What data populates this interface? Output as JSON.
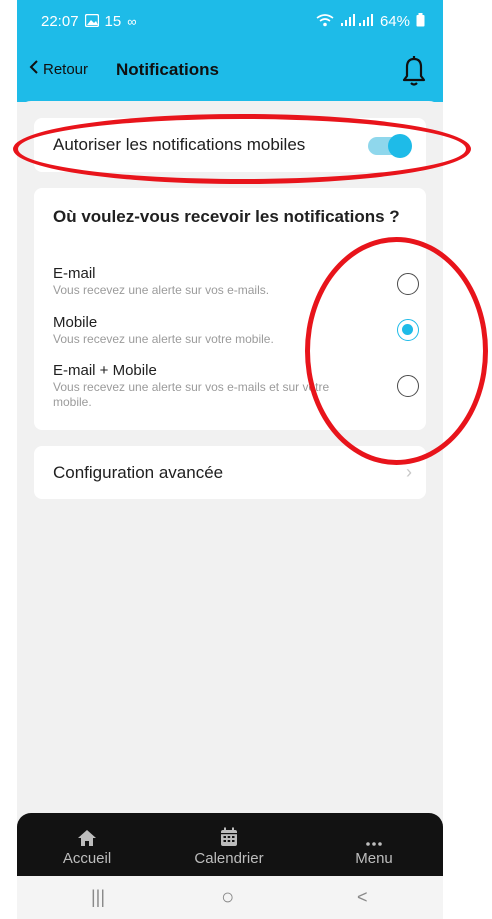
{
  "status_bar": {
    "time": "22:07",
    "extra": "15",
    "battery": "64%"
  },
  "nav": {
    "back_label": "Retour",
    "title": "Notifications",
    "bell_icon": "bell-icon"
  },
  "toggle_card": {
    "label": "Autoriser les notifications mobiles",
    "enabled": true
  },
  "choices": {
    "title": "Où voulez-vous recevoir les notifications ?",
    "options": [
      {
        "label": "E-mail",
        "description": "Vous recevez une alerte sur vos e-mails.",
        "selected": false
      },
      {
        "label": "Mobile",
        "description": "Vous recevez une alerte sur votre mobile.",
        "selected": true
      },
      {
        "label": "E-mail + Mobile",
        "description": "Vous recevez une alerte sur vos e-mails et sur votre mobile.",
        "selected": false
      }
    ]
  },
  "advanced": {
    "label": "Configuration avancée",
    "chevron": "›"
  },
  "tab_bar": {
    "home": "Accueil",
    "calendar": "Calendrier",
    "menu": "Menu"
  },
  "system_nav": {
    "recents": "|||",
    "home": "○",
    "back": "<"
  },
  "colors": {
    "accent": "#1ebbe8",
    "annotation": "#e8141b",
    "tab_bar": "#121212"
  }
}
